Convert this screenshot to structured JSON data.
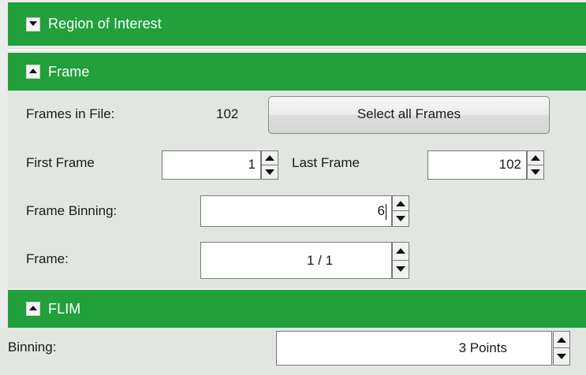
{
  "sections": {
    "roi": {
      "title": "Region of Interest",
      "toggle_icon": "collapse-down-icon",
      "expanded": false
    },
    "frame": {
      "title": "Frame",
      "toggle_icon": "collapse-up-icon",
      "expanded": true
    },
    "flim": {
      "title": "FLIM",
      "toggle_icon": "collapse-up-icon",
      "expanded": true
    }
  },
  "frame": {
    "frames_in_file_label": "Frames in File:",
    "frames_in_file_value": "102",
    "select_all_label": "Select all Frames",
    "first_frame_label": "First Frame",
    "first_frame_value": "1",
    "last_frame_label": "Last Frame",
    "last_frame_value": "102",
    "frame_binning_label": "Frame Binning:",
    "frame_binning_value": "6",
    "frame_label": "Frame:",
    "frame_value": "1 / 1"
  },
  "flim": {
    "binning_label": "Binning:",
    "binning_value": "3 Points"
  },
  "colors": {
    "header_green": "#21a03b",
    "panel_bg": "#e1e6e0",
    "page_bg": "#ececec"
  }
}
